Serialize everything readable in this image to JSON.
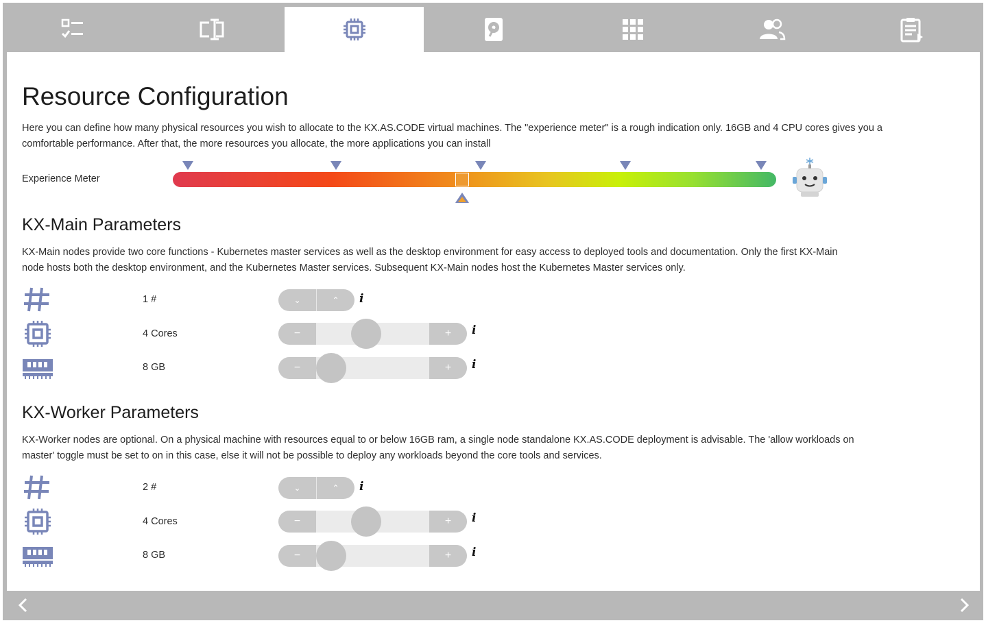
{
  "tabs": [
    {
      "name": "checklist-icon",
      "active": false
    },
    {
      "name": "text-cursor-icon",
      "active": false
    },
    {
      "name": "cpu-chip-icon",
      "active": true
    },
    {
      "name": "hard-disk-icon",
      "active": false
    },
    {
      "name": "apps-grid-icon",
      "active": false
    },
    {
      "name": "users-icon",
      "active": false
    },
    {
      "name": "clipboard-review-icon",
      "active": false
    }
  ],
  "page": {
    "title": "Resource Configuration",
    "description": "Here you can define how many physical resources you wish to allocate to the KX.AS.CODE virtual machines. The \"experience meter\" is a rough indication only. 16GB and 4 CPU cores gives you a comfortable performance. After that, the more resources you allocate, the more applications you can install"
  },
  "experience_meter": {
    "label": "Experience Meter",
    "level": 0.48,
    "tick_positions": [
      0.025,
      0.27,
      0.51,
      0.75,
      0.975
    ],
    "colors": {
      "start": "#e03a4e",
      "mid": "#f08a1c",
      "end": "#44b866",
      "marker": "#ee9a30",
      "tick": "#7986b8"
    }
  },
  "main": {
    "heading": "KX-Main Parameters",
    "description": "KX-Main nodes provide two core functions - Kubernetes master services as well as the desktop environment for easy access to deployed tools and documentation. Only the first KX-Main node hosts both the desktop environment, and the Kubernetes Master services. Subsequent KX-Main nodes host the Kubernetes Master services only.",
    "node_count": {
      "label": "1 #",
      "icon": "hash-icon",
      "down": "⌄",
      "up": "⌃"
    },
    "cores": {
      "label": "4 Cores",
      "icon": "cpu-chip-icon",
      "minus": "−",
      "plus": "+",
      "level": 0.46
    },
    "memory": {
      "label": "8 GB",
      "icon": "memory-module-icon",
      "minus": "−",
      "plus": "+",
      "level": 0.24
    }
  },
  "worker": {
    "heading": "KX-Worker Parameters",
    "description": "KX-Worker nodes are optional. On a physical machine with resources equal to or below 16GB ram, a single node standalone KX.AS.CODE deployment is advisable. The 'allow workloads on master' toggle must be set to on in this case, else it will not be possible to deploy any workloads beyond the core tools and services.",
    "node_count": {
      "label": "2 #",
      "icon": "hash-icon",
      "down": "⌄",
      "up": "⌃"
    },
    "cores": {
      "label": "4 Cores",
      "icon": "cpu-chip-icon",
      "minus": "−",
      "plus": "+",
      "level": 0.46
    },
    "memory": {
      "label": "8 GB",
      "icon": "memory-module-icon",
      "minus": "−",
      "plus": "+",
      "level": 0.24
    }
  },
  "info_label": "i",
  "colors": {
    "icon": "#7986b8",
    "frame": "#b8b8b8",
    "control": "#c8c8c8",
    "track": "#ebebeb"
  }
}
